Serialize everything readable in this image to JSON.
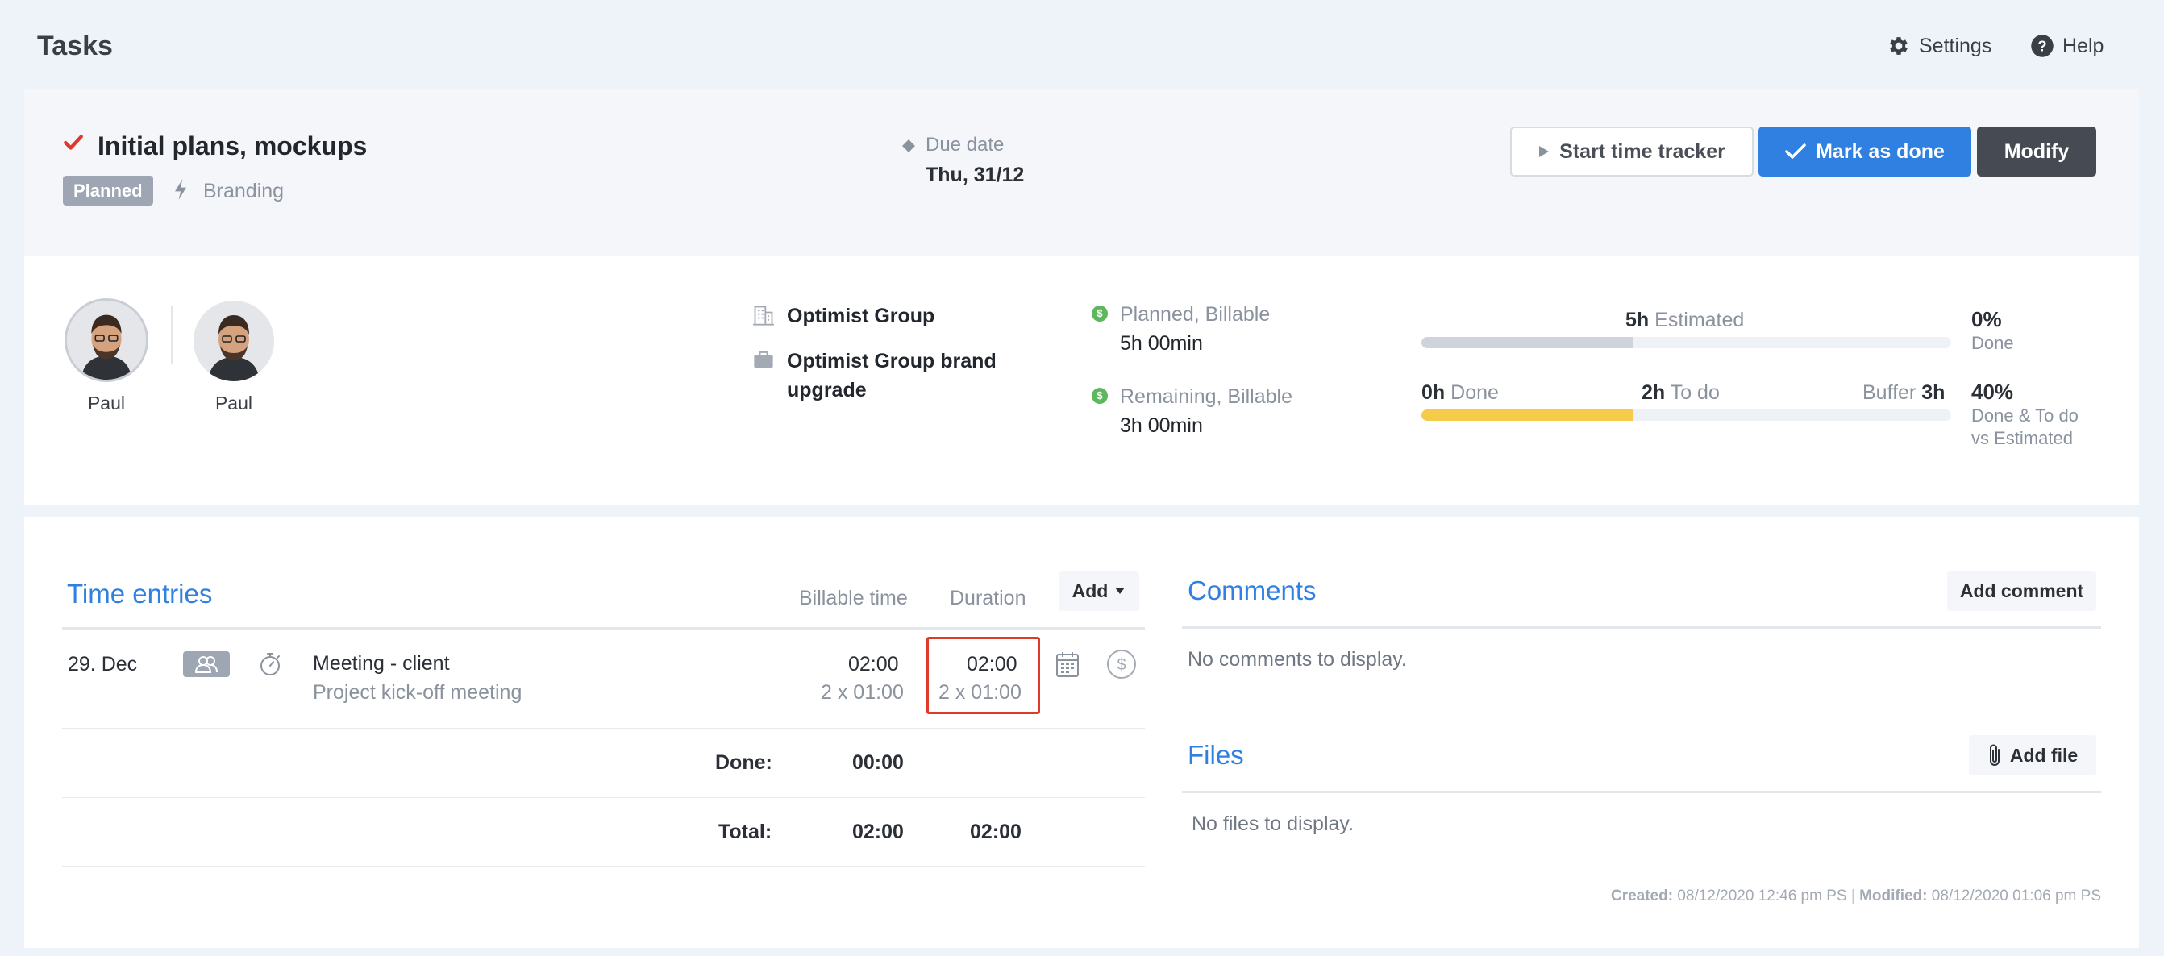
{
  "header": {
    "title": "Tasks",
    "settings_label": "Settings",
    "help_label": "Help"
  },
  "task": {
    "title": "Initial plans, mockups",
    "status_badge": "Planned",
    "tag": "Branding",
    "due_label": "Due date",
    "due_value": "Thu, 31/12",
    "actions": {
      "start_tracker": "Start time tracker",
      "mark_done": "Mark as done",
      "modify": "Modify"
    }
  },
  "assignees": [
    {
      "name": "Paul"
    },
    {
      "name": "Paul"
    }
  ],
  "client": {
    "company": "Optimist Group",
    "project_line1": "Optimist Group brand",
    "project_line2": "upgrade"
  },
  "stats": {
    "planned_label": "Planned, Billable",
    "planned_value": "5h 00min",
    "remaining_label": "Remaining, Billable",
    "remaining_value": "3h 00min"
  },
  "progress": {
    "estimated_value": "5h",
    "estimated_label": "Estimated",
    "estimated_fill": 0.4,
    "done_value": "0h",
    "done_label": "Done",
    "todo_value": "2h",
    "todo_label": "To do",
    "buffer_label": "Buffer",
    "buffer_value": "3h",
    "todo_fill": 0.4,
    "pct_done": "0%",
    "pct_done_label": "Done",
    "pct_todo": "40%",
    "pct_todo_label_1": "Done & To do",
    "pct_todo_label_2": "vs Estimated",
    "colors": {
      "track": "#eef1f6",
      "estimated": "#cfd4dc",
      "todo": "#f4cc4a"
    }
  },
  "time_entries": {
    "title": "Time entries",
    "col_billable": "Billable time",
    "col_duration": "Duration",
    "add_label": "Add",
    "rows": [
      {
        "date": "29. Dec",
        "name": "Meeting - client",
        "description": "Project kick-off meeting",
        "billable": "02:00",
        "billable_sub": "2 x 01:00",
        "duration": "02:00",
        "duration_sub": "2 x 01:00"
      }
    ],
    "done_label": "Done:",
    "done_billable": "00:00",
    "total_label": "Total:",
    "total_billable": "02:00",
    "total_duration": "02:00"
  },
  "comments": {
    "title": "Comments",
    "add_label": "Add comment",
    "empty": "No comments to display."
  },
  "files": {
    "title": "Files",
    "add_label": "Add file",
    "empty": "No files to display."
  },
  "footer": {
    "created_label": "Created:",
    "created_value": "08/12/2020 12:46 pm PS",
    "modified_label": "Modified:",
    "modified_value": "08/12/2020 01:06 pm PS"
  },
  "colors": {
    "accent": "#2f80e0",
    "danger": "#e0392b",
    "success": "#5cb85c"
  }
}
